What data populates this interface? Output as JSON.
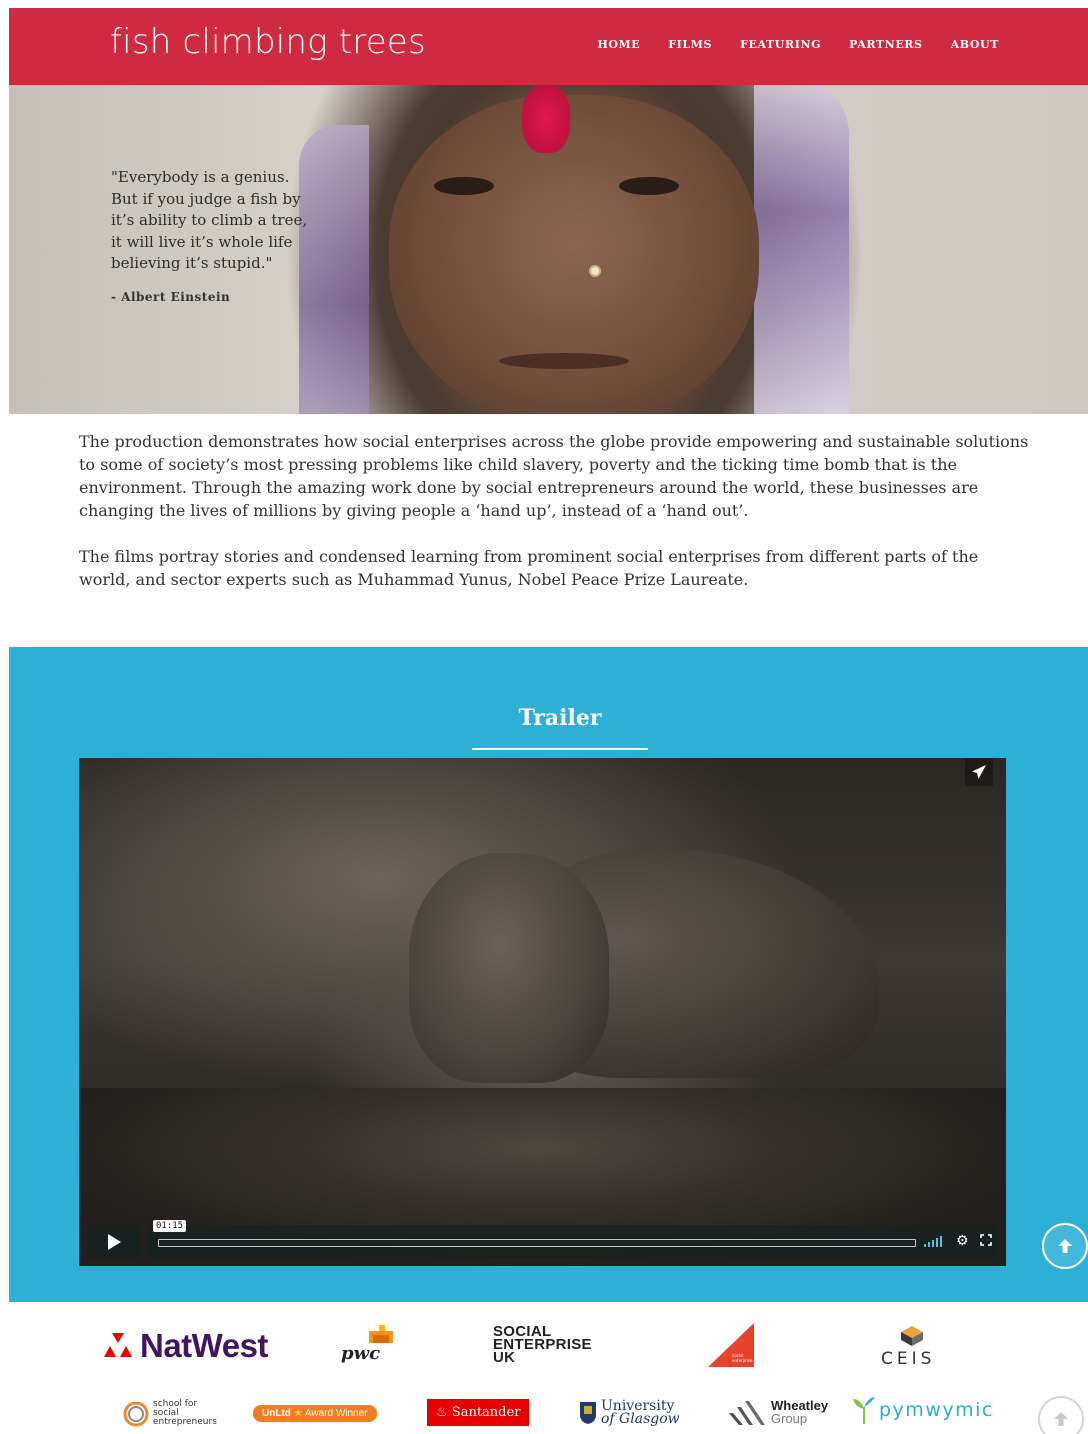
{
  "header": {
    "logo_text": "fish climbing trees",
    "nav": [
      {
        "label": "HOME"
      },
      {
        "label": "FILMS"
      },
      {
        "label": "FEATURING"
      },
      {
        "label": "PARTNERS"
      },
      {
        "label": "ABOUT"
      }
    ],
    "brand_color": "#cf2a3f"
  },
  "hero": {
    "quote_lines": [
      "\"Everybody is a genius.",
      "But if you judge a fish by",
      "it’s ability to climb a tree,",
      "it will live it’s whole life",
      "believing it’s stupid.\""
    ],
    "quote_author": "- Albert Einstein"
  },
  "intro": {
    "paragraphs": [
      "The production demonstrates how social enterprises across the globe provide empowering and sustainable solutions to some of society’s most pressing problems like child slavery, poverty and the ticking time bomb that is the environment. Through the amazing work done by social entrepreneurs around the world, these businesses are changing the lives of millions by giving people a ‘hand up’, instead of a ‘hand out’.",
      "The films portray stories and condensed learning from prominent social enterprises from different parts of the world, and sector experts such as Muhammad Yunus, Nobel Peace Prize Laureate."
    ]
  },
  "trailer": {
    "title": "Trailer",
    "section_color": "#2eb0d6",
    "player": {
      "time": "01:15",
      "share_icon": "paper-plane-icon",
      "play_icon": "play-icon",
      "volume_icon": "volume-bars-icon",
      "settings_icon": "gear-icon",
      "fullscreen_icon": "fullscreen-icon"
    }
  },
  "partners": {
    "row1": {
      "natwest": "NatWest",
      "pwc": "pwc",
      "social_enterprise_uk": [
        "SOCIAL",
        "ENTERPRISE",
        "UK"
      ],
      "social_enterprise_mark": "social enterprise",
      "ceis": "CEIS"
    },
    "row2": {
      "sse": [
        "school for",
        "social",
        "entrepreneurs"
      ],
      "unltd": "UnLtd",
      "unltd_award": "Award Winner",
      "santander": "Santander",
      "glasgow": [
        "University",
        "of Glasgow"
      ],
      "wheatley": [
        "Wheatley",
        "Group"
      ],
      "pymwymic": "pymwymic"
    }
  }
}
